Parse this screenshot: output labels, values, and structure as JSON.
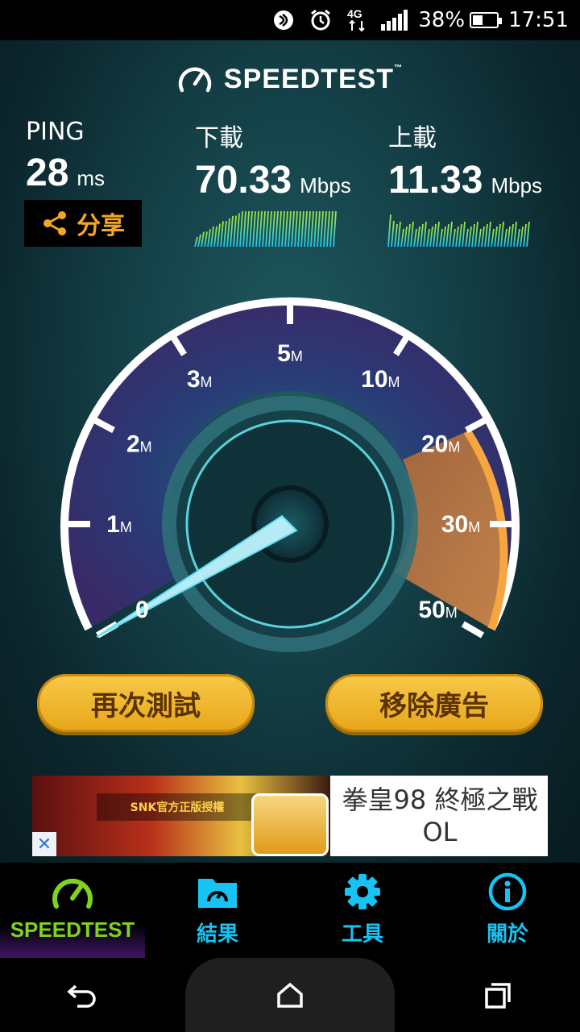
{
  "status_bar": {
    "battery": "38%",
    "time": "17:51",
    "network": "4G",
    "icons": [
      "nfc-icon",
      "alarm-icon",
      "network-4g-icon",
      "signal-icon",
      "battery-icon"
    ]
  },
  "header": {
    "logo": "SPEEDTEST",
    "trademark": "™"
  },
  "results": {
    "ping": {
      "label": "PING",
      "value": "28",
      "unit": "ms"
    },
    "download": {
      "label": "下載",
      "value": "70.33",
      "unit": "Mbps"
    },
    "upload": {
      "label": "上載",
      "value": "11.33",
      "unit": "Mbps"
    }
  },
  "share": {
    "label": "分享"
  },
  "gauge": {
    "ticks": [
      {
        "n": "0",
        "u": ""
      },
      {
        "n": "1",
        "u": "M"
      },
      {
        "n": "2",
        "u": "M"
      },
      {
        "n": "3",
        "u": "M"
      },
      {
        "n": "5",
        "u": "M"
      },
      {
        "n": "10",
        "u": "M"
      },
      {
        "n": "20",
        "u": "M"
      },
      {
        "n": "30",
        "u": "M"
      },
      {
        "n": "50",
        "u": "M"
      }
    ]
  },
  "buttons": {
    "retest": "再次測試",
    "remove_ads": "移除廣告"
  },
  "ad": {
    "text": "拳皇98 終極之戰OL",
    "badge": "SNK官方正版授權"
  },
  "tabs": [
    {
      "label": "SPEEDTEST",
      "icon": "speedometer-icon"
    },
    {
      "label": "結果",
      "icon": "results-folder-icon"
    },
    {
      "label": "工具",
      "icon": "gear-icon"
    },
    {
      "label": "關於",
      "icon": "info-icon"
    }
  ],
  "colors": {
    "accent": "#17c3f2",
    "active": "#7ed321",
    "button": "#f2b632",
    "share": "#f5a623"
  }
}
